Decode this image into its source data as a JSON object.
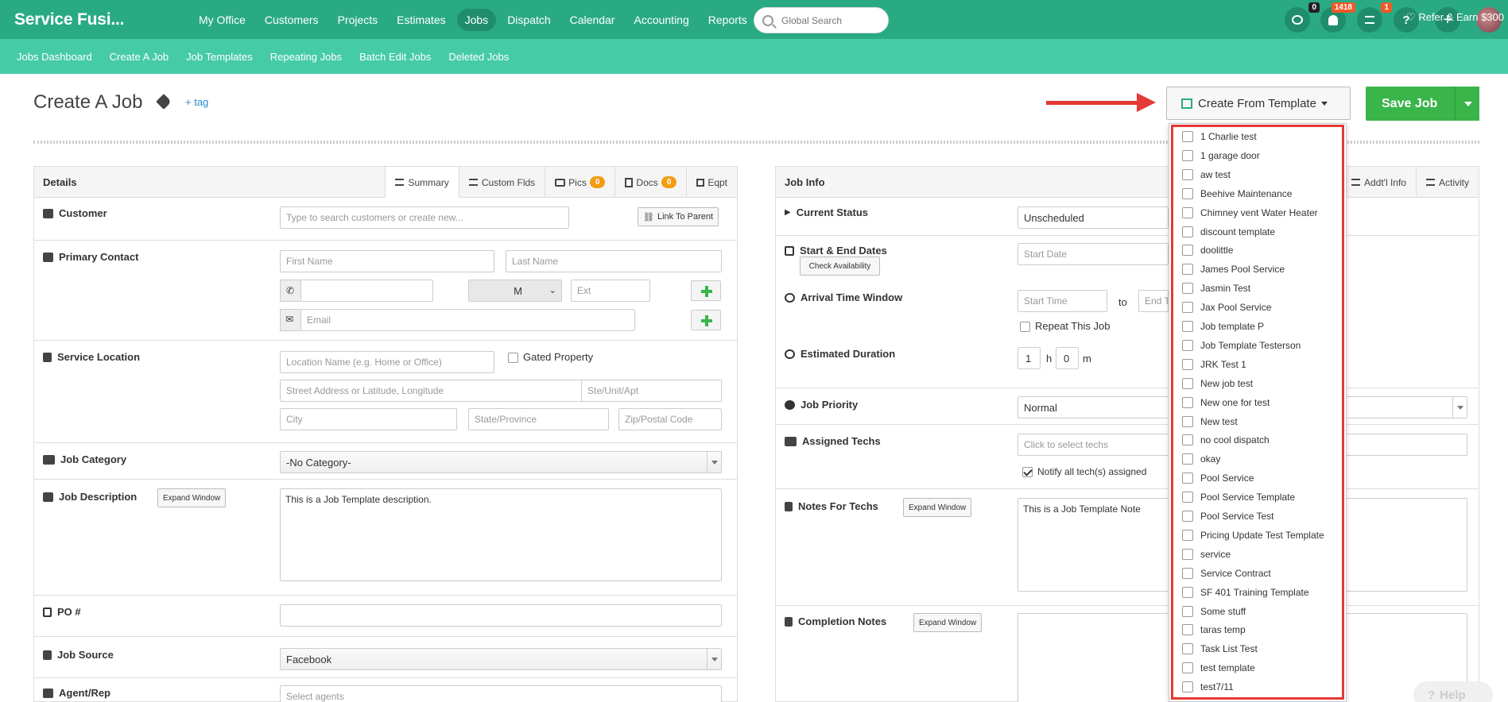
{
  "app": {
    "logo": "Service Fusi..."
  },
  "nav": {
    "items": [
      "My Office",
      "Customers",
      "Projects",
      "Estimates",
      "Jobs",
      "Dispatch",
      "Calendar",
      "Accounting",
      "Reports"
    ],
    "active": "Jobs"
  },
  "search": {
    "placeholder": "Global Search"
  },
  "header_icons": {
    "chat_badge": "0",
    "bell_badge": "1418",
    "list_badge": "1",
    "help": "?",
    "add": "+"
  },
  "subnav": {
    "items": [
      "Jobs Dashboard",
      "Create A Job",
      "Job Templates",
      "Repeating Jobs",
      "Batch Edit Jobs",
      "Deleted Jobs"
    ],
    "refer": "Refer & Earn $300"
  },
  "page": {
    "title": "Create A Job",
    "tag_link": "+ tag",
    "create_from_template": "Create From Template",
    "save_job": "Save Job"
  },
  "details": {
    "title": "Details",
    "tabs": {
      "summary": "Summary",
      "custom_flds": "Custom Flds",
      "pics": "Pics",
      "pics_count": "0",
      "docs": "Docs",
      "docs_count": "0",
      "eqpt": "Eqpt"
    },
    "customer": {
      "label": "Customer",
      "placeholder": "Type to search customers or create new...",
      "link_parent": "Link To Parent"
    },
    "primary_contact": {
      "label": "Primary Contact",
      "first_name": "First Name",
      "last_name": "Last Name",
      "phone_type": "M",
      "ext": "Ext",
      "email": "Email"
    },
    "service_location": {
      "label": "Service Location",
      "location_name": "Location Name (e.g. Home or Office)",
      "gated": "Gated Property",
      "street": "Street Address or Latitude, Longitude",
      "ste": "Ste/Unit/Apt",
      "city": "City",
      "state": "State/Province",
      "zip": "Zip/Postal Code"
    },
    "job_category": {
      "label": "Job Category",
      "value": "-No Category-"
    },
    "job_description": {
      "label": "Job Description",
      "expand": "Expand Window",
      "value": "This is a Job Template description."
    },
    "po": {
      "label": "PO #"
    },
    "job_source": {
      "label": "Job Source",
      "value": "Facebook"
    },
    "agent": {
      "label": "Agent/Rep",
      "placeholder": "Select agents"
    }
  },
  "job_info": {
    "title": "Job Info",
    "tabs": {
      "addl_info": "Addt'l Info",
      "activity": "Activity"
    },
    "current_status": {
      "label": "Current Status",
      "value": "Unscheduled"
    },
    "dates": {
      "label": "Start & End Dates",
      "check": "Check Availability",
      "start": "Start Date"
    },
    "arrival": {
      "label": "Arrival Time Window",
      "start": "Start Time",
      "to": "to",
      "end": "End T",
      "repeat": "Repeat This Job"
    },
    "duration": {
      "label": "Estimated Duration",
      "hours": "1",
      "h": "h",
      "minutes": "0",
      "m": "m"
    },
    "priority": {
      "label": "Job Priority",
      "value": "Normal"
    },
    "techs": {
      "label": "Assigned Techs",
      "placeholder": "Click to select techs",
      "notify": "Notify all tech(s) assigned"
    },
    "notes_techs": {
      "label": "Notes For Techs",
      "expand": "Expand Window",
      "value": "This is a Job Template Note"
    },
    "completion": {
      "label": "Completion Notes",
      "expand": "Expand Window"
    }
  },
  "templates": [
    "1 Charlie test",
    "1 garage door",
    "aw test",
    "Beehive Maintenance",
    "Chimney vent Water Heater",
    "discount template",
    "doolittle",
    "James Pool Service",
    "Jasmin Test",
    "Jax Pool Service",
    "Job template P",
    "Job Template Testerson",
    "JRK Test 1",
    "New job test",
    "New one for test",
    "New test",
    "no cool dispatch",
    "okay",
    "Pool Service",
    "Pool Service Template",
    "Pool Service Test",
    "Pricing Update Test Template",
    "service",
    "Service Contract",
    "SF 401 Training Template",
    "Some stuff",
    "taras temp",
    "Task List Test",
    "test template",
    "test7/11"
  ],
  "help": "Help",
  "colors": {
    "brand": "#2aaa83",
    "subnav": "#46cba7",
    "save": "#39b54a",
    "highlight": "#e53935"
  }
}
